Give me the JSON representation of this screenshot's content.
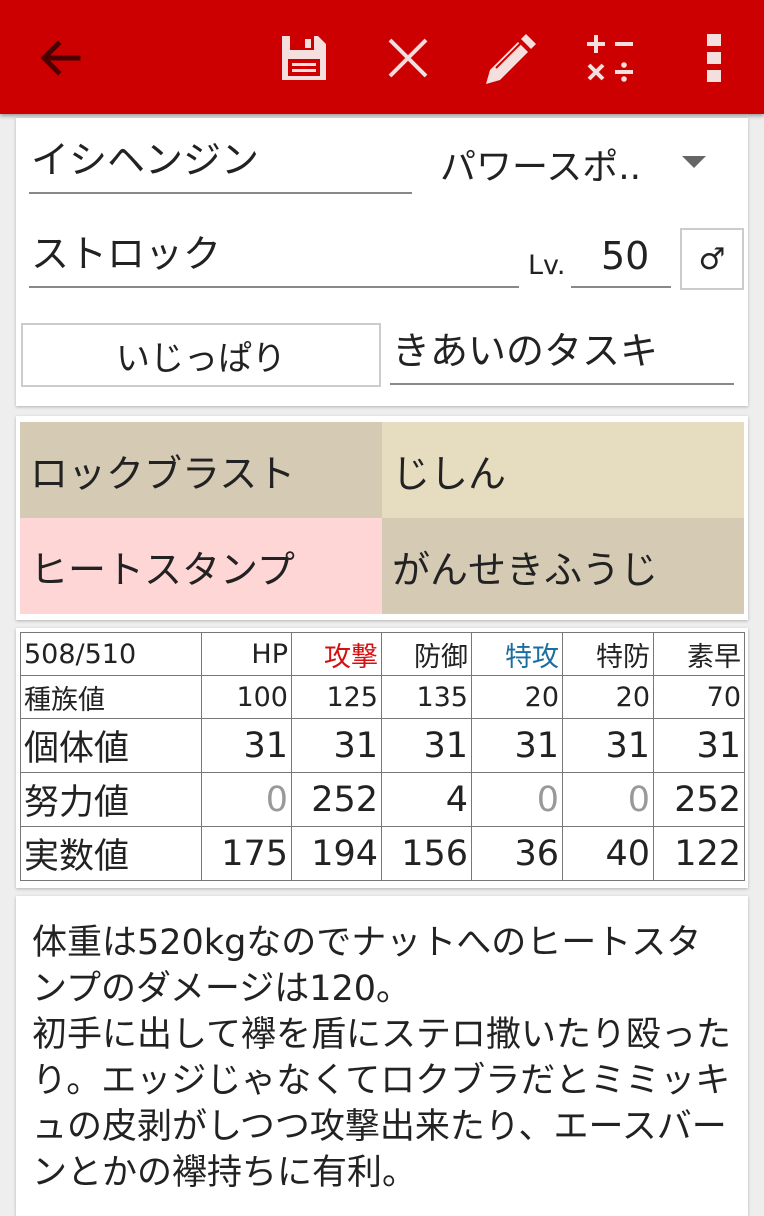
{
  "colors": {
    "toolbar": "#cc0000",
    "move_tan_dark": "#d5cbb4",
    "move_tan_light": "#e6dcc0",
    "move_pink": "#ffd6d6",
    "attack_red": "#d21010",
    "spatk_blue": "#1a6fa0",
    "zero_grey": "#999999"
  },
  "toolbar": {
    "icons": [
      "back-arrow-icon",
      "save-icon",
      "close-icon",
      "edit-pencil-icon",
      "calculator-icon",
      "more-vert-icon"
    ]
  },
  "pokemon": {
    "species": "イシヘンジン",
    "ability": "パワースポ..",
    "nickname": "ストロック",
    "level_label": "Lv.",
    "level": "50",
    "gender": "♂",
    "nature": "いじっぱり",
    "item": "きあいのタスキ"
  },
  "moves": [
    {
      "name": "ロックブラスト",
      "color": "#d5cbb4"
    },
    {
      "name": "じしん",
      "color": "#e6dcc0"
    },
    {
      "name": "ヒートスタンプ",
      "color": "#ffd6d6"
    },
    {
      "name": "がんせきふうじ",
      "color": "#d5cbb4"
    }
  ],
  "stats": {
    "ev_total": "508/510",
    "headers": [
      "HP",
      "攻撃",
      "防御",
      "特攻",
      "特防",
      "素早"
    ],
    "rows": [
      {
        "label": "種族値",
        "values": [
          "100",
          "125",
          "135",
          "20",
          "20",
          "70"
        ]
      },
      {
        "label": "個体値",
        "values": [
          "31",
          "31",
          "31",
          "31",
          "31",
          "31"
        ]
      },
      {
        "label": "努力値",
        "values": [
          "0",
          "252",
          "4",
          "0",
          "0",
          "252"
        ]
      },
      {
        "label": "実数値",
        "values": [
          "175",
          "194",
          "156",
          "36",
          "40",
          "122"
        ]
      }
    ]
  },
  "memo": "体重は520kgなのでナットへのヒートスタンプのダメージは120。\n初手に出して襷を盾にステロ撒いたり殴ったり。エッジじゃなくてロクブラだとミミッキュの皮剥がしつつ攻撃出来たり、エースバーンとかの襷持ちに有利。"
}
